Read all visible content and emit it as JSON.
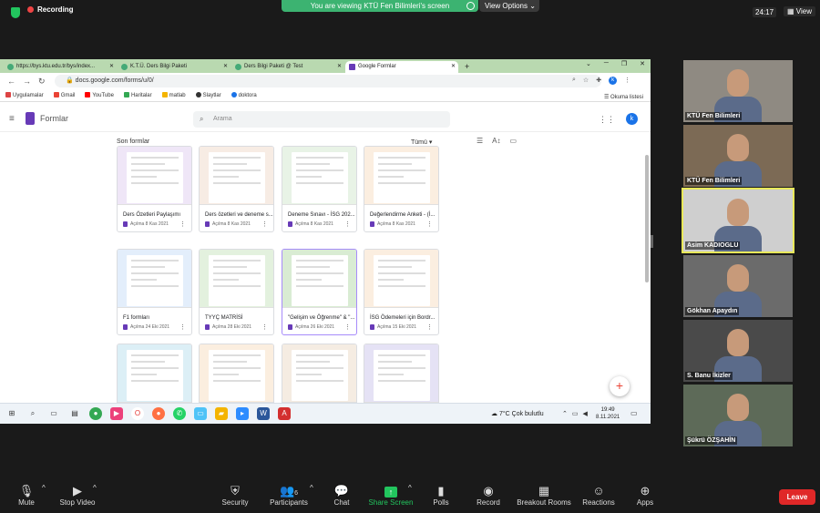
{
  "zoom": {
    "recording_label": "Recording",
    "viewing_banner": "You are viewing KTÜ Fen Bilimleri's screen",
    "view_options_label": "View Options",
    "timer": "24:17",
    "view_label": "View",
    "controls": {
      "mute": "Mute",
      "stop_video": "Stop Video",
      "security": "Security",
      "participants": "Participants",
      "participants_count": "6",
      "chat": "Chat",
      "share_screen": "Share Screen",
      "polls": "Polls",
      "record": "Record",
      "breakout_rooms": "Breakout Rooms",
      "reactions": "Reactions",
      "apps": "Apps",
      "leave": "Leave"
    },
    "participants_tiles": [
      {
        "name": "KTÜ Fen Bilimleri",
        "bg": "#8f8a82",
        "active": false
      },
      {
        "name": "KTÜ Fen Bilimleri",
        "bg": "#7c6a55",
        "active": false
      },
      {
        "name": "Asim KADIOGLU",
        "bg": "#cfcfcf",
        "active": true
      },
      {
        "name": "Gökhan Apaydın",
        "bg": "#6b6b6b",
        "active": false
      },
      {
        "name": "S. Banu İkizler",
        "bg": "#4a4a4a",
        "active": false
      },
      {
        "name": "Şükrü ÖZŞAHİN",
        "bg": "#5d6a58",
        "active": false
      }
    ]
  },
  "browser": {
    "tabs": [
      {
        "title": "https://bys.ktu.edu.tr/bys/index..."
      },
      {
        "title": "K.T.Ü. Ders Bilgi Paketi"
      },
      {
        "title": "Ders Bilgi Paketi @ Test"
      },
      {
        "title": "Google Formlar"
      }
    ],
    "url": "docs.google.com/forms/u/0/",
    "bookmarks": [
      "Uygulamalar",
      "Gmail",
      "YouTube",
      "Haritalar",
      "matlab",
      "Slaytlar",
      "doktora"
    ],
    "reading_list": "Okuma listesi",
    "avatar_letter": "k"
  },
  "forms": {
    "app_title": "Formlar",
    "search_placeholder": "Arama",
    "section_title": "Son formlar",
    "owner_filter": "Tümü",
    "cards": [
      {
        "title": "Ders Özetleri Paylaşımı",
        "meta": "Açılma 8 Kas 2021",
        "tint": "#efe6f7"
      },
      {
        "title": "Ders özetleri ve deneme s...",
        "meta": "Açılma 8 Kas 2021",
        "tint": "#f7ece4"
      },
      {
        "title": "Deneme Sınavı - İSG 202...",
        "meta": "Açılma 8 Kas 2021",
        "tint": "#e8f3e6"
      },
      {
        "title": "Değerlendirme Anketi - (İ...",
        "meta": "Açılma 8 Kas 2021",
        "tint": "#fbeee0"
      },
      {
        "title": "F1 formları",
        "meta": "Açılma 24 Eki 2021",
        "tint": "#e3eefb"
      },
      {
        "title": "TYYÇ MATRİSİ",
        "meta": "Açılma 28 Eki 2021",
        "tint": "#e3f1de"
      },
      {
        "title": "\"Gelişim ve Öğrenme\" & \"...",
        "meta": "Açılma 26 Eki 2021",
        "tint": "#d9ecd3"
      },
      {
        "title": "İSG Ödemeleri için Bordr...",
        "meta": "Açılma 15 Eki 2021",
        "tint": "#fbeee0"
      },
      {
        "title": "",
        "meta": "",
        "tint": "#dceff6"
      },
      {
        "title": "",
        "meta": "",
        "tint": "#fbeedf"
      },
      {
        "title": "",
        "meta": "",
        "tint": "#f5ece2"
      },
      {
        "title": "",
        "meta": "",
        "tint": "#e5e2f5"
      }
    ]
  },
  "taskbar": {
    "weather": "7°C  Çok bulutlu",
    "time": "19:49",
    "date": "8.11.2021"
  }
}
